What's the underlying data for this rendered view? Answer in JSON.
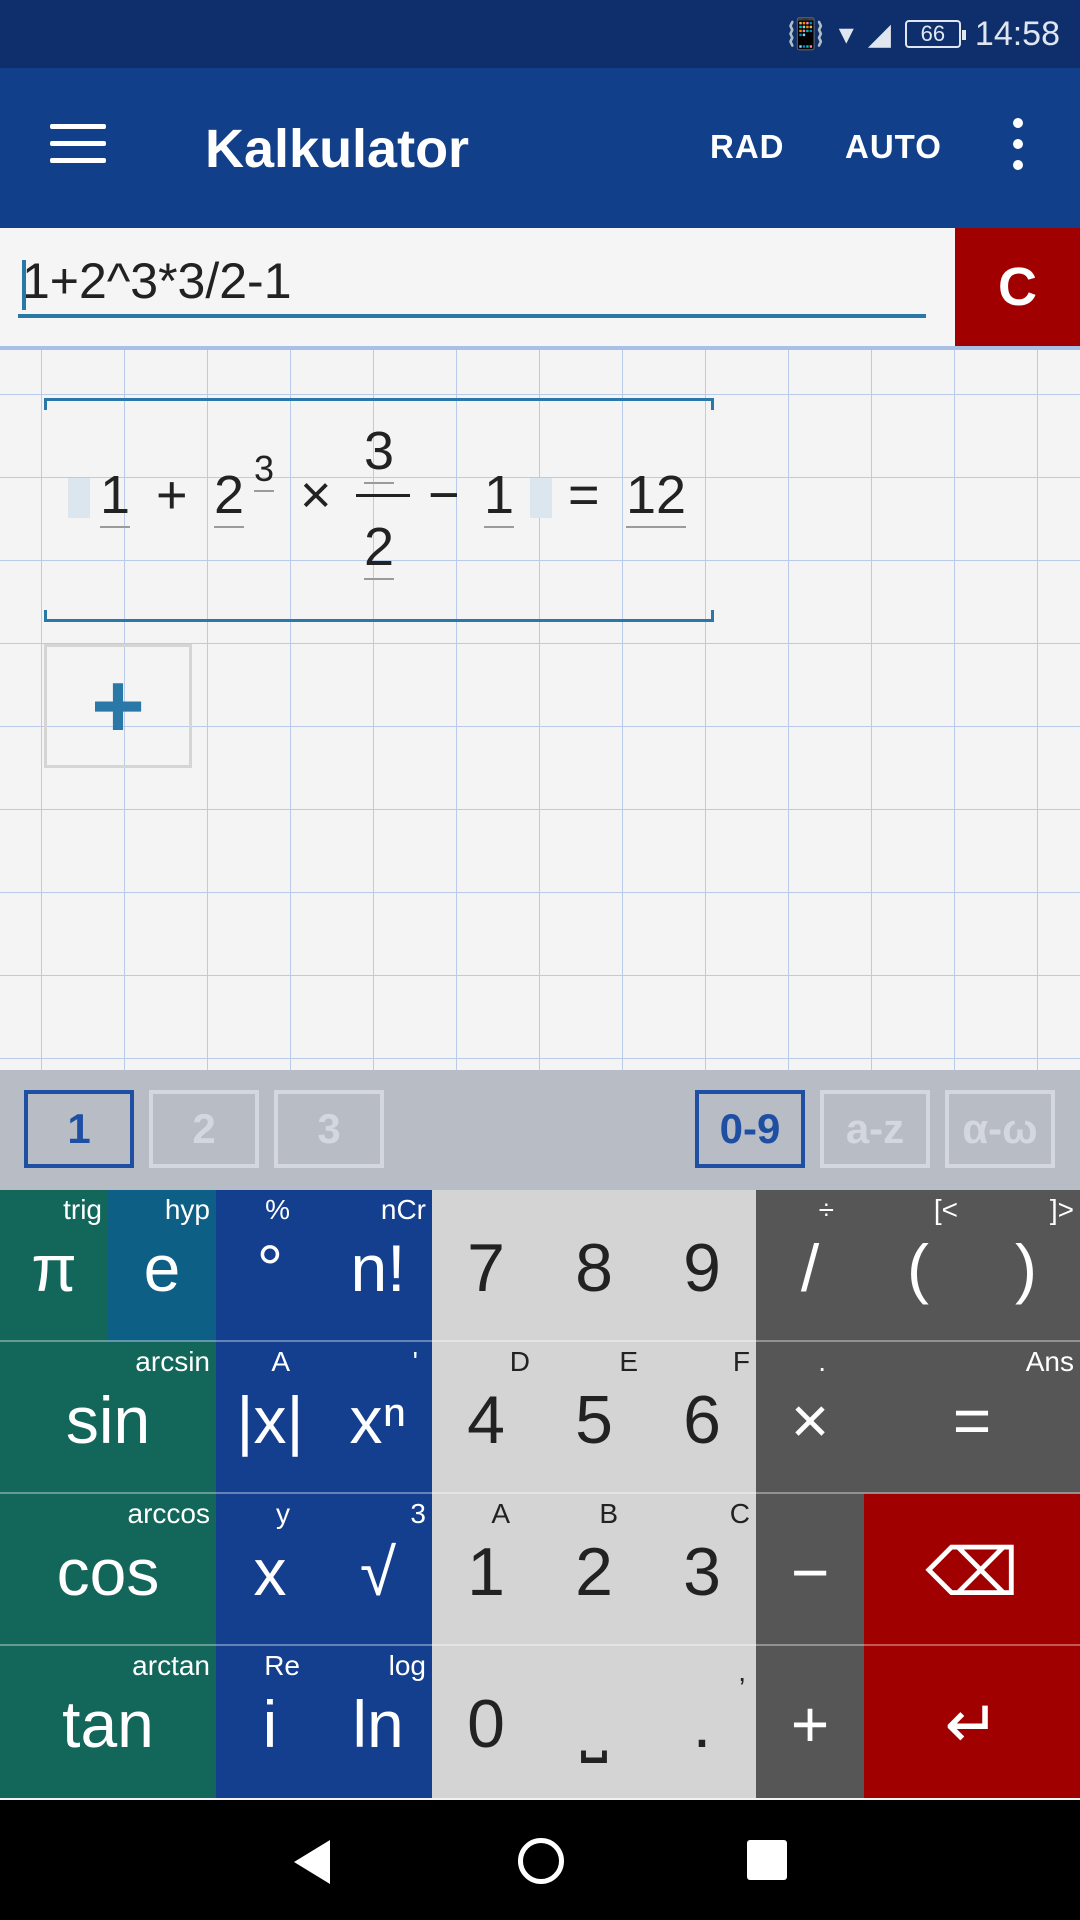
{
  "status": {
    "battery": "66",
    "time": "14:58",
    "vibrate_glyph": "📳",
    "wifi_glyph": "▾",
    "signal_glyph": "◢"
  },
  "appbar": {
    "title": "Kalkulator",
    "rad_label": "RAD",
    "auto_label": "AUTO"
  },
  "input": {
    "value": "1+2^3*3/2-1",
    "clear_label": "C"
  },
  "expression": {
    "t1": "1",
    "op_plus": "+",
    "base": "2",
    "exp": "3",
    "op_times": "×",
    "num": "3",
    "den": "2",
    "op_minus": "−",
    "t2": "1",
    "eq": "=",
    "result": "12"
  },
  "add_label": "+",
  "tabs": [
    "1",
    "2",
    "3"
  ],
  "keyboards": [
    "0-9",
    "a-z",
    "α-ω"
  ],
  "keys": {
    "pi": {
      "main": "π",
      "sub": "trig"
    },
    "e": {
      "main": "e",
      "sub": "hyp"
    },
    "deg": {
      "main": "°",
      "sub": "%"
    },
    "fact": {
      "main": "n!",
      "sub": "nCr"
    },
    "k7": {
      "main": "7"
    },
    "k8": {
      "main": "8"
    },
    "k9": {
      "main": "9"
    },
    "div": {
      "main": "/",
      "sub": "÷"
    },
    "lparen": {
      "main": "(",
      "sub": "[<"
    },
    "rparen": {
      "main": ")",
      "sub": "]>"
    },
    "sin": {
      "main": "sin",
      "sub": "arcsin"
    },
    "abs": {
      "main": "|x|",
      "sub": "A"
    },
    "pow": {
      "main": "xⁿ",
      "sub": "'"
    },
    "k4": {
      "main": "4",
      "sub": "D"
    },
    "k5": {
      "main": "5",
      "sub": "E"
    },
    "k6": {
      "main": "6",
      "sub": "F"
    },
    "mul": {
      "main": "×",
      "sub": "."
    },
    "eq": {
      "main": "=",
      "sub": "Ans"
    },
    "cos": {
      "main": "cos",
      "sub": "arccos"
    },
    "x": {
      "main": "x",
      "sub": "y"
    },
    "sqrt": {
      "main": "√",
      "sub": "3"
    },
    "k1": {
      "main": "1",
      "sub": "A"
    },
    "k2": {
      "main": "2",
      "sub": "B"
    },
    "k3": {
      "main": "3",
      "sub": "C"
    },
    "minus": {
      "main": "−"
    },
    "back": {
      "main": "⌫"
    },
    "tan": {
      "main": "tan",
      "sub": "arctan"
    },
    "i": {
      "main": "i",
      "sub": "Re"
    },
    "ln": {
      "main": "ln",
      "sub": "log"
    },
    "k0": {
      "main": "0"
    },
    "space": {
      "main": "⎵"
    },
    "dot": {
      "main": ".",
      "sub": ","
    },
    "plus": {
      "main": "+"
    },
    "enter": {
      "main": "↵"
    }
  }
}
